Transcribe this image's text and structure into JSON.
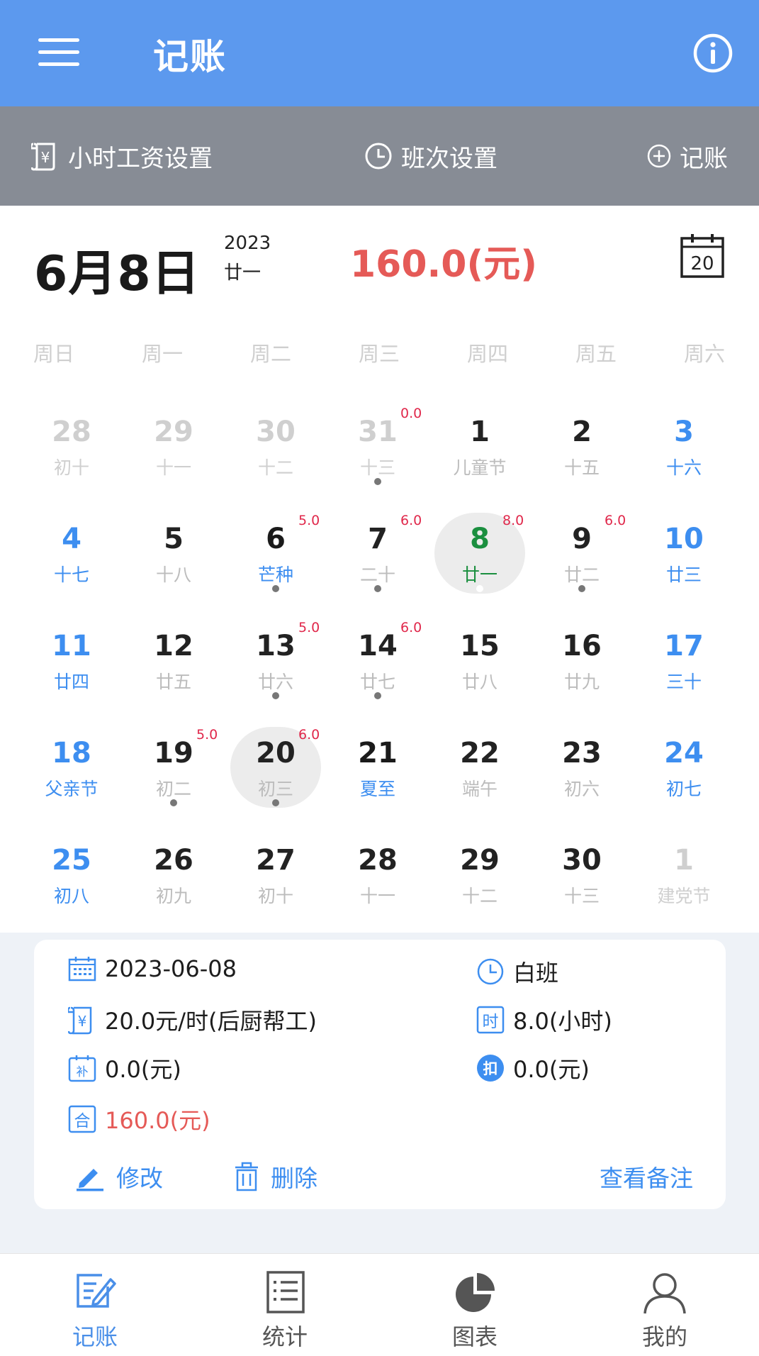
{
  "header": {
    "title": "记账",
    "menu_icon": "menu-icon",
    "info_icon": "info-icon",
    "bg_color": "#5c99ee"
  },
  "toolbar": {
    "wage_label": "小时工资设置",
    "shift_label": "班次设置",
    "add_label": "记账"
  },
  "day_header": {
    "date": "6月8日",
    "year": "2023",
    "lunar": "廿一",
    "total": "160.0(元)",
    "today_icon_text": "20"
  },
  "weekdays": [
    "周日",
    "周一",
    "周二",
    "周三",
    "周四",
    "周五",
    "周六"
  ],
  "calendar": {
    "rows": [
      [
        {
          "day": "28",
          "lunar": "初十",
          "type": "other"
        },
        {
          "day": "29",
          "lunar": "十一",
          "type": "other"
        },
        {
          "day": "30",
          "lunar": "十二",
          "type": "other"
        },
        {
          "day": "31",
          "lunar": "十三",
          "type": "other",
          "amount": "0.0",
          "dot": true
        },
        {
          "day": "1",
          "lunar": "儿童节",
          "type": "day"
        },
        {
          "day": "2",
          "lunar": "十五",
          "type": "day"
        },
        {
          "day": "3",
          "lunar": "十六",
          "type": "we"
        }
      ],
      [
        {
          "day": "4",
          "lunar": "十七",
          "type": "we"
        },
        {
          "day": "5",
          "lunar": "十八",
          "type": "day"
        },
        {
          "day": "6",
          "lunar": "芒种",
          "type": "fest",
          "amount": "5.0",
          "dot": true
        },
        {
          "day": "7",
          "lunar": "二十",
          "type": "day",
          "amount": "6.0",
          "dot": true
        },
        {
          "day": "8",
          "lunar": "廿一",
          "type": "sel",
          "amount": "8.0",
          "dot": true,
          "highlight": true
        },
        {
          "day": "9",
          "lunar": "廿二",
          "type": "day",
          "amount": "6.0",
          "dot": true
        },
        {
          "day": "10",
          "lunar": "廿三",
          "type": "we"
        }
      ],
      [
        {
          "day": "11",
          "lunar": "廿四",
          "type": "we"
        },
        {
          "day": "12",
          "lunar": "廿五",
          "type": "day"
        },
        {
          "day": "13",
          "lunar": "廿六",
          "type": "day",
          "amount": "5.0",
          "dot": true
        },
        {
          "day": "14",
          "lunar": "廿七",
          "type": "day",
          "amount": "6.0",
          "dot": true
        },
        {
          "day": "15",
          "lunar": "廿八",
          "type": "day"
        },
        {
          "day": "16",
          "lunar": "廿九",
          "type": "day"
        },
        {
          "day": "17",
          "lunar": "三十",
          "type": "we"
        }
      ],
      [
        {
          "day": "18",
          "lunar": "父亲节",
          "type": "we"
        },
        {
          "day": "19",
          "lunar": "初二",
          "type": "day",
          "amount": "5.0",
          "dot": true
        },
        {
          "day": "20",
          "lunar": "初三",
          "type": "day",
          "amount": "6.0",
          "dot": true,
          "highlight": true
        },
        {
          "day": "21",
          "lunar": "夏至",
          "type": "fest"
        },
        {
          "day": "22",
          "lunar": "端午",
          "type": "day"
        },
        {
          "day": "23",
          "lunar": "初六",
          "type": "day"
        },
        {
          "day": "24",
          "lunar": "初七",
          "type": "we"
        }
      ],
      [
        {
          "day": "25",
          "lunar": "初八",
          "type": "we"
        },
        {
          "day": "26",
          "lunar": "初九",
          "type": "day"
        },
        {
          "day": "27",
          "lunar": "初十",
          "type": "day"
        },
        {
          "day": "28",
          "lunar": "十一",
          "type": "day"
        },
        {
          "day": "29",
          "lunar": "十二",
          "type": "day"
        },
        {
          "day": "30",
          "lunar": "十三",
          "type": "day"
        },
        {
          "day": "1",
          "lunar": "建党节",
          "type": "other"
        }
      ]
    ]
  },
  "record": {
    "date": "2023-06-08",
    "shift": "白班",
    "wage": "20.0元/时(后厨帮工)",
    "hours": "8.0(小时)",
    "subsidy": "0.0(元)",
    "deduction": "0.0(元)",
    "total": "160.0(元)",
    "edit_label": "修改",
    "delete_label": "删除",
    "notes_label": "查看备注",
    "hour_badge": "时",
    "subsidy_badge": "补",
    "deduct_badge": "扣",
    "total_badge": "合",
    "wage_badge": "¥"
  },
  "bottom_nav": [
    {
      "label": "记账",
      "icon": "edit-note-icon",
      "active": true
    },
    {
      "label": "统计",
      "icon": "list-icon",
      "active": false
    },
    {
      "label": "图表",
      "icon": "pie-chart-icon",
      "active": false
    },
    {
      "label": "我的",
      "icon": "user-icon",
      "active": false
    }
  ],
  "colors": {
    "accent": "#3d8ef0",
    "toolbar": "#878c95",
    "amount_red": "#e55a57",
    "cell_amount": "#e0284b",
    "selected_green": "#1b8f3f"
  }
}
